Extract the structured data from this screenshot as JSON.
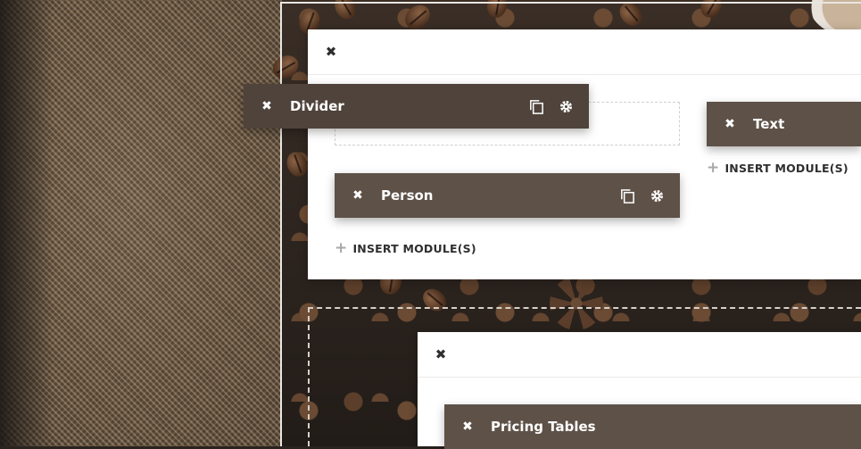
{
  "modules": {
    "divider": {
      "title": "Divider",
      "close_icon": "close-icon",
      "duplicate_icon": "duplicate-icon",
      "settings_icon": "gear-icon"
    },
    "text": {
      "title": "Text",
      "close_icon": "close-icon"
    },
    "person": {
      "title": "Person",
      "close_icon": "close-icon",
      "duplicate_icon": "duplicate-icon",
      "settings_icon": "gear-icon"
    },
    "pricing": {
      "title": "Pricing Tables",
      "close_icon": "close-icon"
    }
  },
  "insert_modules_label": "INSERT MODULE(S)",
  "colors": {
    "module_bg": "#5e5148",
    "panel_bg": "#ffffff",
    "text_dark": "#2f2f2f",
    "plus_icon": "#a7a7a7"
  }
}
